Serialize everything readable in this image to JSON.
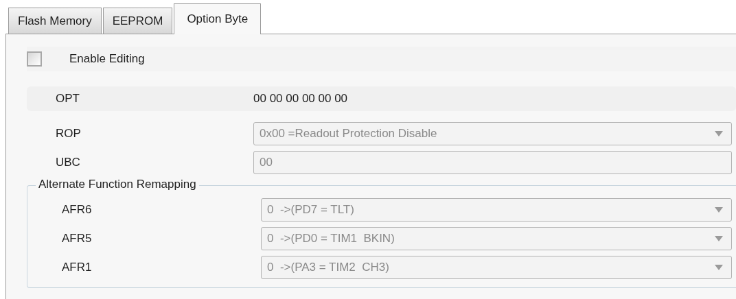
{
  "tabs": [
    {
      "label": "Flash Memory",
      "selected": false
    },
    {
      "label": "EEPROM",
      "selected": false
    },
    {
      "label": "Option Byte",
      "selected": true
    }
  ],
  "enable_editing": {
    "label": "Enable Editing",
    "checked": false
  },
  "opt": {
    "label": "OPT",
    "value": "00 00 00 00 00 00"
  },
  "fields": [
    {
      "label": "ROP",
      "kind": "dropdown",
      "value": "0x00 =Readout Protection Disable",
      "disabled": true
    },
    {
      "label": "UBC",
      "kind": "text",
      "value": "00",
      "disabled": true
    }
  ],
  "group": {
    "title": "Alternate Function Remapping",
    "fields": [
      {
        "label": "AFR6",
        "kind": "dropdown",
        "value": "0  ->(PD7 = TLT)",
        "disabled": true
      },
      {
        "label": "AFR5",
        "kind": "dropdown",
        "value": "0  ->(PD0 = TIM1  BKIN)",
        "disabled": true
      },
      {
        "label": "AFR1",
        "kind": "dropdown",
        "value": "0  ->(PA3 = TIM2  CH3)",
        "disabled": true
      }
    ]
  }
}
